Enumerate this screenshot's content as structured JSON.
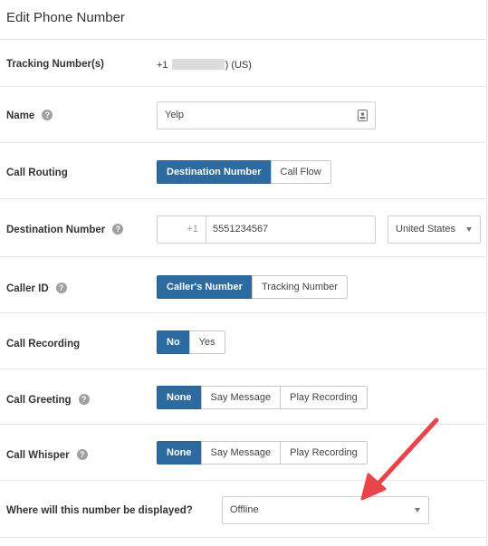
{
  "header": {
    "title": "Edit Phone Number"
  },
  "tracking": {
    "label": "Tracking Number(s)",
    "prefix": "+1",
    "suffix": ") (US)"
  },
  "name": {
    "label": "Name",
    "help": "?",
    "value": "Yelp"
  },
  "call_routing": {
    "label": "Call Routing",
    "options": [
      "Destination Number",
      "Call Flow"
    ],
    "selected": "Destination Number"
  },
  "destination": {
    "label": "Destination Number",
    "help": "?",
    "country_code": "+1",
    "number": "5551234567",
    "country": "United States"
  },
  "caller_id": {
    "label": "Caller ID",
    "help": "?",
    "options": [
      "Caller's Number",
      "Tracking Number"
    ],
    "selected": "Caller's Number"
  },
  "call_recording": {
    "label": "Call Recording",
    "options": [
      "No",
      "Yes"
    ],
    "selected": "No"
  },
  "call_greeting": {
    "label": "Call Greeting",
    "help": "?",
    "options": [
      "None",
      "Say Message",
      "Play Recording"
    ],
    "selected": "None"
  },
  "call_whisper": {
    "label": "Call Whisper",
    "help": "?",
    "options": [
      "None",
      "Say Message",
      "Play Recording"
    ],
    "selected": "None"
  },
  "display": {
    "label": "Where will this number be displayed?",
    "value": "Offline"
  },
  "colors": {
    "primary": "#2c6aa0",
    "arrow": "#e8454a"
  }
}
